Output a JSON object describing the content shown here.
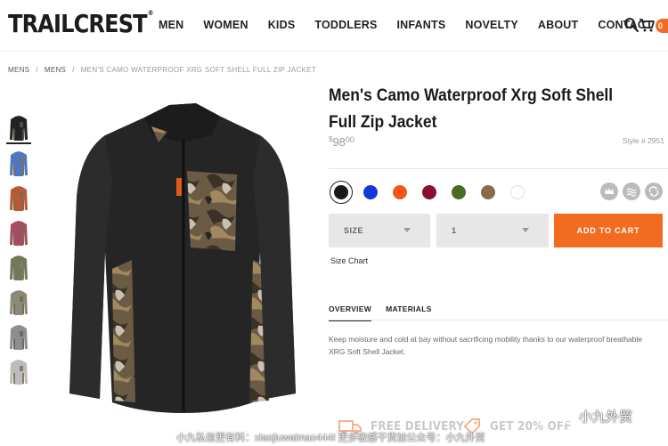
{
  "header": {
    "logo": "TRAILCREST",
    "logo_mark": "®",
    "nav": [
      "MEN",
      "WOMEN",
      "KIDS",
      "TODDLERS",
      "INFANTS",
      "NOVELTY",
      "ABOUT",
      "CONTACT"
    ],
    "cart_count": "0"
  },
  "breadcrumb": [
    "MENS",
    "MENS",
    "MEN'S CAMO WATERPROOF XRG SOFT SHELL FULL ZIP JACKET"
  ],
  "product": {
    "title": "Men's Camo Waterproof Xrg Soft Shell Full Zip Jacket",
    "price_symbol": "$",
    "price_dollars": "98",
    "price_cents": "00",
    "style_no": "Style # 2951",
    "colors": [
      "#1a1a1a",
      "#1537d8",
      "#f4561a",
      "#8a1030",
      "#4a6b23",
      "#8a6a4a",
      "#ffffff"
    ],
    "selected_color_index": 0,
    "feature_icons": [
      "crown-icon",
      "waves-icon",
      "recycle-icon"
    ],
    "size_label": "SIZE",
    "qty_value": "1",
    "add_to_cart": "ADD TO CART",
    "size_chart": "Size Chart",
    "tabs": [
      "OVERVIEW",
      "MATERIALS"
    ],
    "description": "Keep moisture and cold at bay without sacrificing mobility thanks to our waterproof breathable XRG Soft Shell Jacket."
  },
  "thumbnails": [
    {
      "color": "#222222",
      "accent": "#5a4a38"
    },
    {
      "color": "#4a78c2",
      "accent": "#8a6a4a"
    },
    {
      "color": "#b85a38",
      "accent": "#7a6a50"
    },
    {
      "color": "#a84a60",
      "accent": "#7a6a50"
    },
    {
      "color": "#6f7a5a",
      "accent": "#8a7a58"
    },
    {
      "color": "#8a8a78",
      "accent": "#7a6a50"
    },
    {
      "color": "#8e8e8e",
      "accent": "#6a6a6a"
    },
    {
      "color": "#bcbcbc",
      "accent": "#8a7a60"
    }
  ],
  "promo": {
    "delivery": "FREE DELIVERY",
    "discount": "GET 20% OFF"
  },
  "watermark": {
    "line": "小九私信更有料：xiaojiuwaimao444I  更多敏感干货加公众号：小九外贸",
    "brand": "小九外贸"
  }
}
